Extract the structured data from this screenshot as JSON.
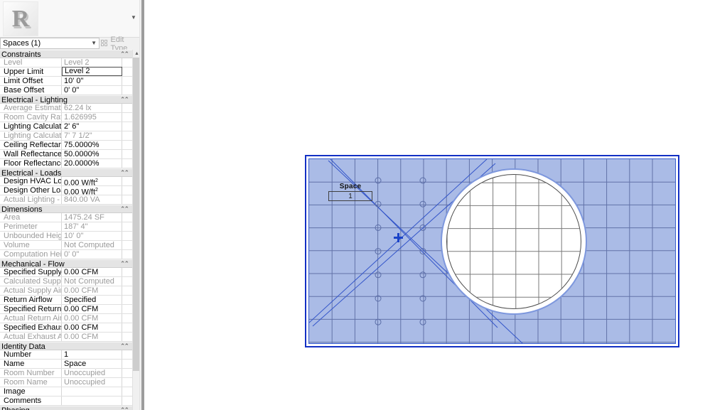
{
  "palette": {
    "thumbnail_glyph": "R",
    "type_selector": {
      "value": "Spaces (1)",
      "chevron": "chevron-down-icon"
    },
    "edit_type_label": "Edit Type",
    "collapse_glyph": "«",
    "groups": [
      {
        "name": "Constraints",
        "rows": [
          {
            "label": "Level",
            "value": "Level 2",
            "dim": true
          },
          {
            "label": "Upper Limit",
            "value": "Level 2",
            "dim": false,
            "focus": true
          },
          {
            "label": "Limit Offset",
            "value": "10'  0\"",
            "dim": false
          },
          {
            "label": "Base Offset",
            "value": "0'  0\"",
            "dim": false
          }
        ]
      },
      {
        "name": "Electrical - Lighting",
        "rows": [
          {
            "label": "Average Estimated I...",
            "value": "62.24 lx",
            "dim": true
          },
          {
            "label": "Room Cavity Ratio",
            "value": "1.626995",
            "dim": true
          },
          {
            "label": "Lighting Calculatio...",
            "value": "2'  6\"",
            "dim": false
          },
          {
            "label": "Lighting Calculatio...",
            "value": "7'  7 1/2\"",
            "dim": true
          },
          {
            "label": "Ceiling Reflectance",
            "value": "75.0000%",
            "dim": false
          },
          {
            "label": "Wall Reflectance",
            "value": "50.0000%",
            "dim": false
          },
          {
            "label": "Floor Reflectance",
            "value": "20.0000%",
            "dim": false
          }
        ]
      },
      {
        "name": "Electrical - Loads",
        "rows": [
          {
            "label": "Design HVAC Load ...",
            "value": "0.00 W/ft",
            "sup": "2",
            "dim": false
          },
          {
            "label": "Design Other Load ...",
            "value": "0.00 W/ft",
            "sup": "2",
            "dim": false
          },
          {
            "label": "Actual Lighting - D...",
            "value": "840.00 VA",
            "dim": true
          }
        ]
      },
      {
        "name": "Dimensions",
        "rows": [
          {
            "label": "Area",
            "value": "1475.24 SF",
            "dim": true
          },
          {
            "label": "Perimeter",
            "value": "187'  4\"",
            "dim": true
          },
          {
            "label": "Unbounded Height",
            "value": "10'  0\"",
            "dim": true
          },
          {
            "label": "Volume",
            "value": "Not Computed",
            "dim": true
          },
          {
            "label": "Computation Height",
            "value": "0'  0\"",
            "dim": true
          }
        ]
      },
      {
        "name": "Mechanical - Flow",
        "rows": [
          {
            "label": "Specified Supply Air...",
            "value": "0.00 CFM",
            "dim": false
          },
          {
            "label": "Calculated Supply A...",
            "value": "Not Computed",
            "dim": true
          },
          {
            "label": "Actual Supply Airflow",
            "value": "0.00 CFM",
            "dim": true
          },
          {
            "label": "Return Airflow",
            "value": "Specified",
            "dim": false
          },
          {
            "label": "Specified Return Air...",
            "value": "0.00 CFM",
            "dim": false
          },
          {
            "label": "Actual Return Airflow",
            "value": "0.00 CFM",
            "dim": true
          },
          {
            "label": "Specified Exhaust Ai...",
            "value": "0.00 CFM",
            "dim": false
          },
          {
            "label": "Actual Exhaust Airfl...",
            "value": "0.00 CFM",
            "dim": true
          }
        ]
      },
      {
        "name": "Identity Data",
        "rows": [
          {
            "label": "Number",
            "value": "1",
            "dim": false
          },
          {
            "label": "Name",
            "value": "Space",
            "dim": false
          },
          {
            "label": "Room Number",
            "value": "Unoccupied",
            "dim": true
          },
          {
            "label": "Room Name",
            "value": "Unoccupied",
            "dim": true
          },
          {
            "label": "Image",
            "value": "",
            "dim": false
          },
          {
            "label": "Comments",
            "value": "",
            "dim": false
          }
        ]
      },
      {
        "name": "Phasing",
        "rows": []
      }
    ]
  },
  "canvas": {
    "space_tag": {
      "label": "Space",
      "number": "1"
    },
    "colors": {
      "space_fill": "#aabbe6",
      "selection_border": "#1330c4",
      "grid_line": "#6272a8",
      "diagonal_line": "#3355c9",
      "void_outline": "#4a4a4a",
      "void_fill": "#ffffff",
      "void_halo": "#7d97dd"
    }
  }
}
